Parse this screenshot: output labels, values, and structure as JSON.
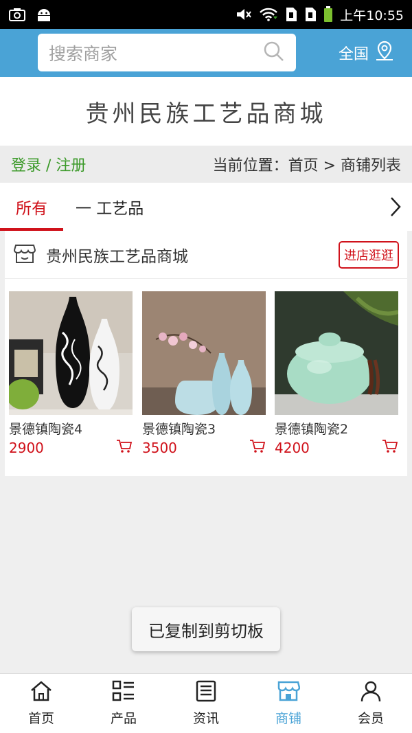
{
  "status_bar": {
    "time": "上午10:55",
    "icons": [
      "screenshot-icon",
      "android-icon",
      "mute-icon",
      "wifi-icon",
      "sim1-icon",
      "sim2-icon",
      "battery-icon"
    ]
  },
  "header": {
    "search_placeholder": "搜索商家",
    "region_label": "全国"
  },
  "site_title": "贵州民族工艺品商城",
  "crumb_bar": {
    "login_label": "登录 / 注册",
    "location_label": "当前位置：首页 > 商铺列表"
  },
  "tabs": [
    {
      "label": "所有",
      "active": true
    },
    {
      "label": "一 工艺品",
      "active": false
    }
  ],
  "shop": {
    "name": "贵州民族工艺品商城",
    "visit_label": "进店逛逛",
    "products": [
      {
        "name": "景德镇陶瓷4",
        "price": "2900"
      },
      {
        "name": "景德镇陶瓷3",
        "price": "3500"
      },
      {
        "name": "景德镇陶瓷2",
        "price": "4200"
      }
    ]
  },
  "toast": "已复制到剪切板",
  "bottom_nav": [
    {
      "label": "首页",
      "icon": "home-icon"
    },
    {
      "label": "产品",
      "icon": "list-icon"
    },
    {
      "label": "资讯",
      "icon": "news-icon"
    },
    {
      "label": "商铺",
      "icon": "store-icon",
      "active": true
    },
    {
      "label": "会员",
      "icon": "user-icon"
    }
  ],
  "colors": {
    "header_blue": "#4aa3d6",
    "accent_red": "#d0121b",
    "login_green": "#3c9a2a"
  }
}
